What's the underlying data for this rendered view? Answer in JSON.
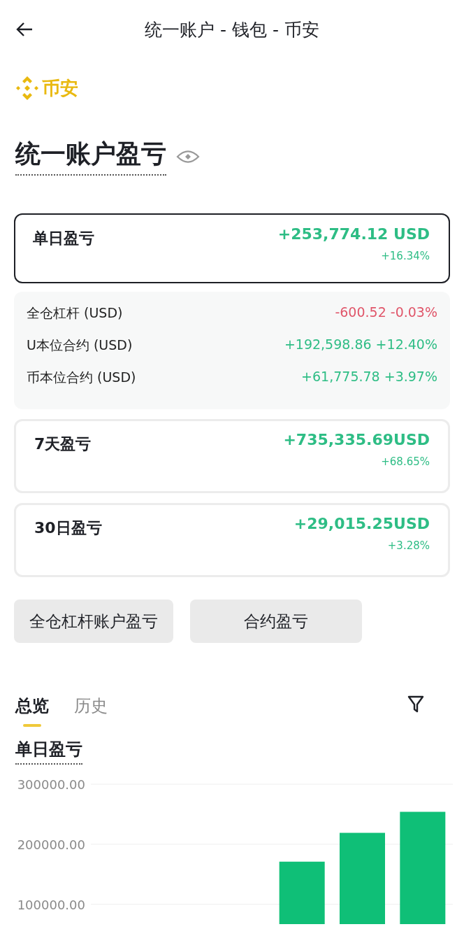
{
  "header": {
    "title": "统一账户 - 钱包 - 币安"
  },
  "brand": {
    "name": "币安"
  },
  "page_title": "统一账户盈亏",
  "daily_card": {
    "label": "单日盈亏",
    "value": "+253,774.12 USD",
    "change": "+16.34%",
    "color": "#2ebd85",
    "selected": true
  },
  "breakdown": [
    {
      "label": "全仓杠杆 (USD)",
      "value": "-600.52 -0.03%",
      "color": "#e0566a"
    },
    {
      "label": "U本位合约 (USD)",
      "value": "+192,598.86 +12.40%",
      "color": "#2ebd85"
    },
    {
      "label": "币本位合约 (USD)",
      "value": "+61,775.78 +3.97%",
      "color": "#2ebd85"
    }
  ],
  "period_cards": [
    {
      "label": "7天盈亏",
      "value": "+735,335.69USD",
      "change": "+68.65%",
      "color": "#2ebd85",
      "selected": false
    },
    {
      "label": "30日盈亏",
      "value": "+29,015.25USD",
      "change": "+3.28%",
      "color": "#2ebd85",
      "selected": false
    }
  ],
  "buttons": [
    "全仓杠杆账户盈亏",
    "合约盈亏"
  ],
  "tabs": [
    {
      "label": "总览",
      "selected": true
    },
    {
      "label": "历史",
      "selected": false
    }
  ],
  "section_title": "单日盈亏",
  "chart": {
    "chart_data": {
      "type": "bar",
      "values": [
        null,
        null,
        null,
        171000,
        219000,
        254000
      ],
      "ylim": [
        67000,
        300000
      ],
      "yticks": [
        {
          "value": 300000,
          "label": "300000.00"
        },
        {
          "value": 200000,
          "label": "200000.00"
        },
        {
          "value": 100000,
          "label": "100000.00"
        }
      ]
    }
  }
}
